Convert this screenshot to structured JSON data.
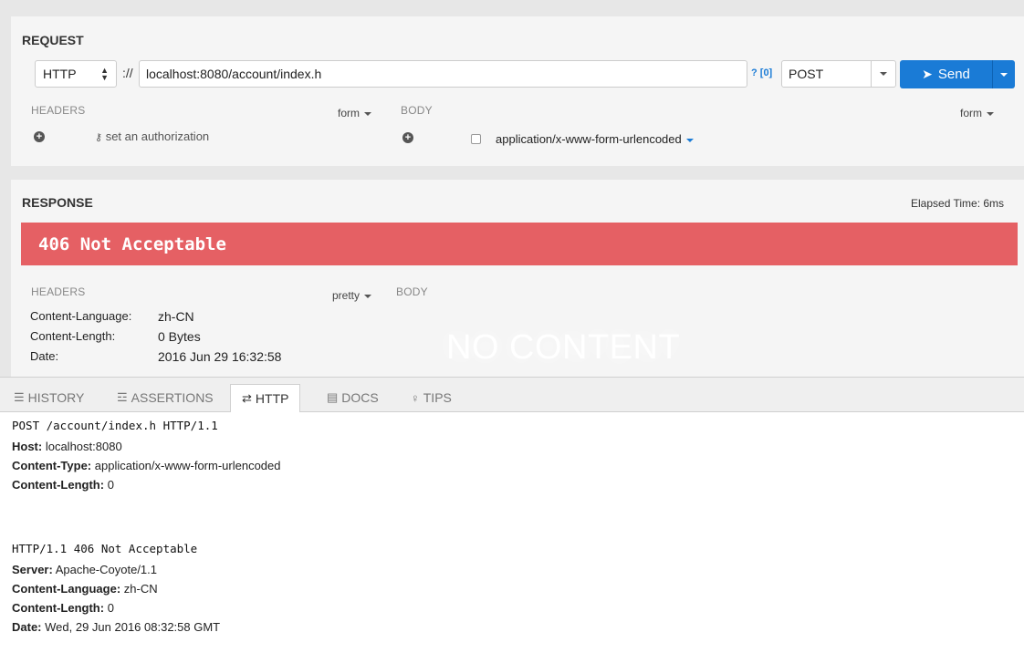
{
  "request": {
    "title": "REQUEST",
    "protocol": "HTTP",
    "scheme_sep": "://",
    "url": "localhost:8080/account/index.h",
    "help_link": "? [0]",
    "method": "POST",
    "send_label": "Send",
    "headers_label": "HEADERS",
    "headers_format": "form",
    "body_label": "BODY",
    "body_format": "form",
    "auth_label": "set an authorization",
    "content_type": "application/x-www-form-urlencoded"
  },
  "response": {
    "title": "RESPONSE",
    "elapsed": "Elapsed Time: 6ms",
    "status": "406 Not Acceptable",
    "headers_label": "HEADERS",
    "headers_format": "pretty",
    "body_label": "BODY",
    "no_content": "NO CONTENT",
    "headers": [
      {
        "name": "Content-Language:",
        "value": "zh-CN"
      },
      {
        "name": "Content-Length:",
        "value": "0 Bytes"
      },
      {
        "name": "Date:",
        "value": "2016 Jun 29 16:32:58"
      }
    ]
  },
  "tabs": [
    {
      "label": "HISTORY",
      "icon": "list-icon"
    },
    {
      "label": "ASSERTIONS",
      "icon": "assertions-icon"
    },
    {
      "label": "HTTP",
      "icon": "exchange-icon",
      "active": true
    },
    {
      "label": "DOCS",
      "icon": "book-icon"
    },
    {
      "label": "TIPS",
      "icon": "lightbulb-icon"
    }
  ],
  "http": {
    "request_line": "POST /account/index.h HTTP/1.1",
    "request_headers": [
      {
        "name": "Host:",
        "value": " localhost:8080"
      },
      {
        "name": "Content-Type:",
        "value": " application/x-www-form-urlencoded"
      },
      {
        "name": "Content-Length:",
        "value": " 0"
      }
    ],
    "status_line": "HTTP/1.1 406 Not Acceptable",
    "response_headers": [
      {
        "name": "Server:",
        "value": " Apache-Coyote/1.1"
      },
      {
        "name": "Content-Language:",
        "value": " zh-CN"
      },
      {
        "name": "Content-Length:",
        "value": " 0"
      },
      {
        "name": "Date:",
        "value": " Wed, 29 Jun 2016 08:32:58 GMT"
      }
    ]
  },
  "colors": {
    "accent": "#1a7bd6",
    "error": "#e56064"
  }
}
